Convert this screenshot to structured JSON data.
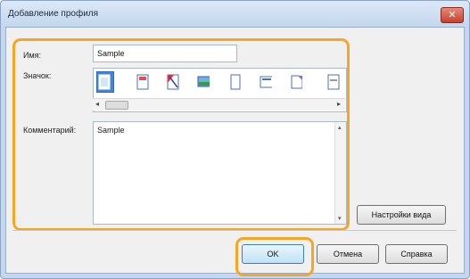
{
  "window": {
    "title": "Добавление профиля",
    "close_glyph": "✕"
  },
  "form": {
    "name_label": "Имя:",
    "name_value": "Sample",
    "icon_label": "Значок:",
    "comment_label": "Комментарий:",
    "comment_value": "Sample"
  },
  "icons": [
    {
      "name": "document-plain-icon",
      "selected": true
    },
    {
      "name": "document-color-icon",
      "selected": false
    },
    {
      "name": "document-red-corner-icon",
      "selected": false
    },
    {
      "name": "photo-landscape-icon",
      "selected": false
    },
    {
      "name": "document-blank-icon",
      "selected": false
    },
    {
      "name": "document-wide-icon",
      "selected": false
    },
    {
      "name": "document-fold-icon",
      "selected": false
    },
    {
      "name": "document-text-icon",
      "selected": false
    }
  ],
  "scroll": {
    "left_arrow": "◂",
    "right_arrow": "▸",
    "up_arrow": "▴",
    "down_arrow": "▾"
  },
  "buttons": {
    "view_settings": "Настройки вида",
    "ok": "OK",
    "cancel": "Отмена",
    "help": "Справка"
  },
  "colors": {
    "highlight": "#f5a623",
    "selection": "#3f88d8"
  }
}
